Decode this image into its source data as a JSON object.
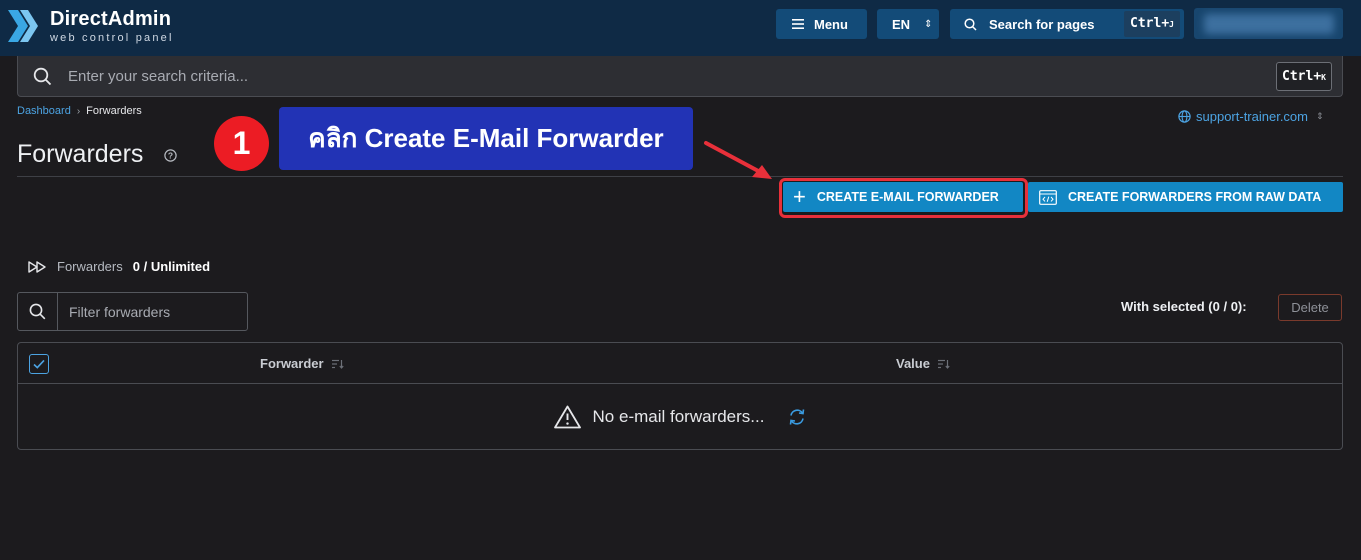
{
  "header": {
    "logo_title": "DirectAdmin",
    "logo_subtitle": "web control panel",
    "menu_label": "Menu",
    "language": "EN",
    "search_label": "Search for pages",
    "search_shortcut": "Ctrl+",
    "search_shortcut_key": "J"
  },
  "search": {
    "placeholder": "Enter your search criteria...",
    "shortcut": "Ctrl+",
    "shortcut_key": "K"
  },
  "breadcrumb": {
    "home": "Dashboard",
    "current": "Forwarders"
  },
  "domain_selector": "support-trainer.com",
  "page_title": "Forwarders",
  "annotation": {
    "step_number": "1",
    "text": "คลิก Create E-Mail Forwarder"
  },
  "actions": {
    "create_label": "CREATE E-MAIL FORWARDER",
    "raw_label": "CREATE FORWARDERS FROM RAW DATA"
  },
  "quota": {
    "label": "Forwarders",
    "value": "0 / Unlimited"
  },
  "filter": {
    "placeholder": "Filter forwarders"
  },
  "bulk": {
    "with_selected": "With selected (0 / 0):",
    "delete_label": "Delete"
  },
  "table": {
    "columns": [
      "Forwarder",
      "Value"
    ],
    "empty_message": "No e-mail forwarders..."
  },
  "colors": {
    "header_bg": "#0f2a45",
    "page_bg": "#1c1b1e",
    "accent": "#1287c4",
    "link": "#4ca3e2",
    "annotation_red": "#ec1c24",
    "annotation_blue": "#2233b5"
  }
}
